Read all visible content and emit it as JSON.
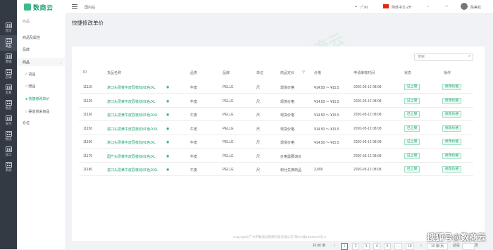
{
  "brand": {
    "logo_text": "数商云"
  },
  "rail": [
    {
      "label": "首页"
    },
    {
      "label": "商品"
    },
    {
      "label": "营销"
    },
    {
      "label": "店铺"
    },
    {
      "label": "交易"
    },
    {
      "label": "售后"
    },
    {
      "label": "支付"
    },
    {
      "label": "物流"
    },
    {
      "label": "加工"
    },
    {
      "label": "系统"
    }
  ],
  "subnav": {
    "section": "商品",
    "items": [
      "商品及属性",
      "品牌",
      "商品",
      "货品",
      "赠品",
      "快捷修改单价",
      "渠道货采商品",
      "仓位"
    ]
  },
  "topbar": {
    "page": "国内站",
    "city": "广州",
    "lang": "简体中文-ZH",
    "user": "陈美欢"
  },
  "page": {
    "title": "快捷修改单价",
    "search_placeholder": "搜索"
  },
  "table": {
    "headers": [
      "ID",
      "货品名称",
      "品类",
      "品牌",
      "单位",
      "商品定价",
      "价格",
      "申请审核时间",
      "状态",
      "操作"
    ],
    "rows": [
      {
        "id": "11110",
        "name": "进口头层黄牛皮荔枝纹/红色/XL",
        "cat": "牛皮",
        "brand": "PELLE",
        "unit": "尺",
        "pricing": "现货价格",
        "price": "¥14.50 ～ ¥15.5",
        "time": "2020-05-12 08:08",
        "status": "已上架",
        "op": "修改价格"
      },
      {
        "id": "11120",
        "name": "进口头层黄牛皮荔枝纹/红色/XL",
        "cat": "牛皮",
        "brand": "PELLE",
        "unit": "尺",
        "pricing": "现货价格",
        "price": "¥14.50 ～ ¥15.5",
        "time": "2020-05-12 08:08",
        "status": "已上架",
        "op": "修改价格"
      },
      {
        "id": "11130",
        "name": "进口头层黄牛皮荔枝纹/红色/XXL",
        "cat": "牛皮",
        "brand": "PELLE",
        "unit": "尺",
        "pricing": "现货价格",
        "price": "¥14.50 ～ ¥15.5",
        "time": "2020-05-12 08:08",
        "status": "已上架",
        "op": "修改价格"
      },
      {
        "id": "11150",
        "name": "进口头层黄牛皮荔枝纹/红色/XXL",
        "cat": "牛皮",
        "brand": "PELLE",
        "unit": "尺",
        "pricing": "现货价格",
        "price": "¥14.50 ～ ¥15.5",
        "time": "2020-05-12 08:08",
        "status": "已上架",
        "op": "修改价格"
      },
      {
        "id": "11160",
        "name": "进口头层黄牛皮荔枝纹/红色/XL",
        "cat": "牛皮",
        "brand": "PELLE",
        "unit": "尺",
        "pricing": "现货价格",
        "price": "¥14.50 ～ ¥15.5",
        "time": "2020-05-12 08:08",
        "status": "已上架",
        "op": "修改价格"
      },
      {
        "id": "11170",
        "name": "国产头层黄牛皮荔枝纹/红色/XL",
        "cat": "牛皮",
        "brand": "PELLE",
        "unit": "尺",
        "pricing": "价格需要询价",
        "price": "",
        "time": "2020-05-12 08:08",
        "status": "已上架",
        "op": "修改价格"
      },
      {
        "id": "11180",
        "name": "进口头层黄牛皮荔枝纹/红色/XXL",
        "cat": "牛皮",
        "brand": "PELLE",
        "unit": "尺",
        "pricing": "积分兑换商品",
        "price": "2,000",
        "time": "2020-05-12 08:08",
        "status": "已上架",
        "op": "修改价格"
      }
    ]
  },
  "pagination": {
    "total": "共 80 条",
    "pages": [
      "1",
      "2",
      "3",
      "4",
      "5",
      "…",
      "10"
    ],
    "size": "10 条/页",
    "jump_label": "前往",
    "jump_unit": "页"
  },
  "footer": "Copyright©广州市数商云网络科技有限公司 粤ICP备18044797号-3",
  "corner_watermark": "搜狐号@数商云",
  "colors": {
    "accent": "#1aa36a",
    "rail": "#333a44"
  }
}
